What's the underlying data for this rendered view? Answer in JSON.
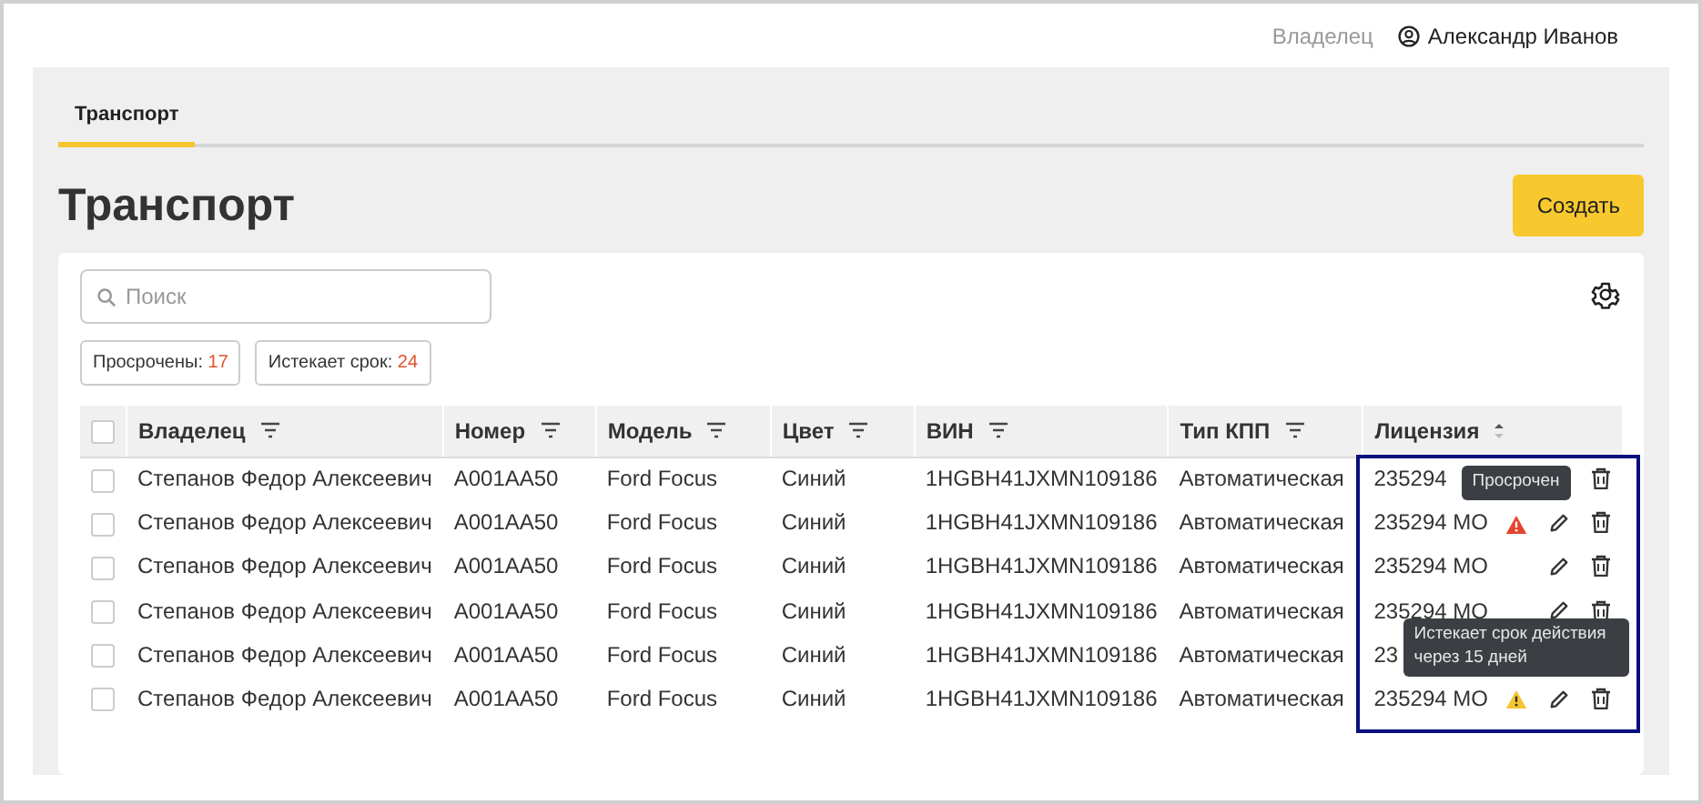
{
  "header": {
    "role": "Владелец",
    "user": "Александр Иванов"
  },
  "tabs": [
    {
      "label": "Транспорт",
      "selected": true
    }
  ],
  "page_title": "Транспорт",
  "create_button": "Создать",
  "search": {
    "placeholder": "Поиск"
  },
  "chips": [
    {
      "label": "Просрочены:",
      "count": "17"
    },
    {
      "label": "Истекает срок:",
      "count": "24"
    }
  ],
  "table": {
    "select_all_checked": false,
    "columns": [
      {
        "label": "Владелец",
        "kind": "filter"
      },
      {
        "label": "Номер",
        "kind": "filter"
      },
      {
        "label": "Модель",
        "kind": "filter"
      },
      {
        "label": "Цвет",
        "kind": "filter"
      },
      {
        "label": "ВИН",
        "kind": "filter"
      },
      {
        "label": "Тип КПП",
        "kind": "filter"
      },
      {
        "label": "Лицензия",
        "kind": "sort"
      }
    ],
    "rows": [
      {
        "checked": false,
        "cells": [
          "Степанов Федор Алексеевич",
          "A001AA50",
          "Ford Focus",
          "Синий",
          "1HGBH41JXMN109186",
          "Автоматическая",
          "235294"
        ]
      },
      {
        "checked": false,
        "cells": [
          "Степанов Федор Алексеевич",
          "A001AA50",
          "Ford Focus",
          "Синий",
          "1HGBH41JXMN109186",
          "Автоматическая",
          "235294 МО"
        ],
        "expired": true,
        "expiring": false,
        "tooltip": "Просрочен"
      },
      {
        "checked": false,
        "cells": [
          "Степанов Федор Алексеевич",
          "A001AA50",
          "Ford Focus",
          "Синий",
          "1HGBH41JXMN109186",
          "Автоматическая",
          "235294 МО"
        ],
        "expired": false,
        "expiring": false
      },
      {
        "checked": false,
        "cells": [
          "Степанов Федор Алексеевич",
          "A001AA50",
          "Ford Focus",
          "Синий",
          "1HGBH41JXMN109186",
          "Автоматическая",
          "235294 МО"
        ],
        "expired": false,
        "expiring": false
      },
      {
        "checked": false,
        "cells": [
          "Степанов Федор Алексеевич",
          "A001AA50",
          "Ford Focus",
          "Синий",
          "1HGBH41JXMN109186",
          "Автоматическая",
          "23"
        ]
      },
      {
        "checked": false,
        "cells": [
          "Степанов Федор Алексеевич",
          "A001AA50",
          "Ford Focus",
          "Синий",
          "1HGBH41JXMN109186",
          "Автоматическая",
          "235294 МО"
        ],
        "expired": false,
        "expiring": true,
        "tooltip": "Истекает срок действия через 15 дней"
      }
    ]
  }
}
